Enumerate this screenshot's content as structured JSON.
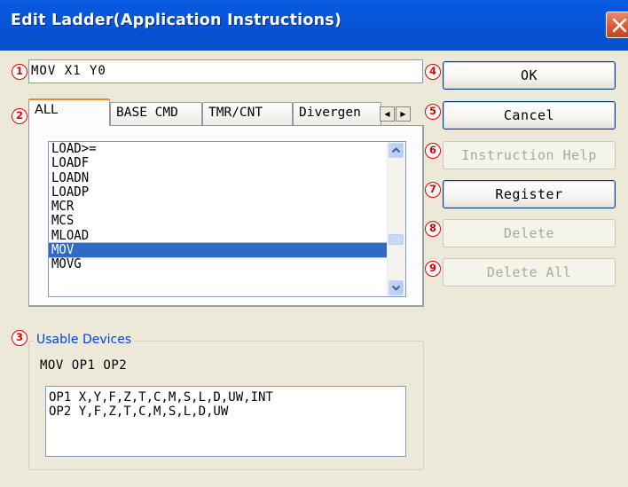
{
  "window": {
    "title": "Edit Ladder(Application Instructions)"
  },
  "badges": [
    "1",
    "2",
    "3",
    "4",
    "5",
    "6",
    "7",
    "8",
    "9"
  ],
  "command_input": {
    "value": "MOV X1 Y0"
  },
  "tabs": [
    {
      "label": "ALL",
      "active": true
    },
    {
      "label": "BASE CMD",
      "active": false
    },
    {
      "label": "TMR/CNT",
      "active": false
    },
    {
      "label": "Divergen",
      "active": false
    }
  ],
  "tab_scroll": {
    "left": "◀",
    "right": "▶"
  },
  "instruction_list": {
    "items": [
      "LOAD>=",
      "LOADF",
      "LOADN",
      "LOADP",
      "MCR",
      "MCS",
      "MLOAD",
      "MOV",
      "MOVG"
    ],
    "selected": "MOV"
  },
  "usable_devices": {
    "legend": "Usable Devices",
    "syntax": "MOV OP1 OP2",
    "lines": [
      "OP1 X,Y,F,Z,T,C,M,S,L,D,UW,INT",
      "OP2 Y,F,Z,T,C,M,S,L,D,UW"
    ]
  },
  "buttons": {
    "ok": "OK",
    "cancel": "Cancel",
    "instruction_help": "Instruction Help",
    "register": "Register",
    "delete": "Delete",
    "delete_all": "Delete All"
  },
  "colors": {
    "titlebar": "#0553d6",
    "selection": "#316ac5",
    "badge": "#e00000",
    "legend_text": "#0046d5"
  }
}
